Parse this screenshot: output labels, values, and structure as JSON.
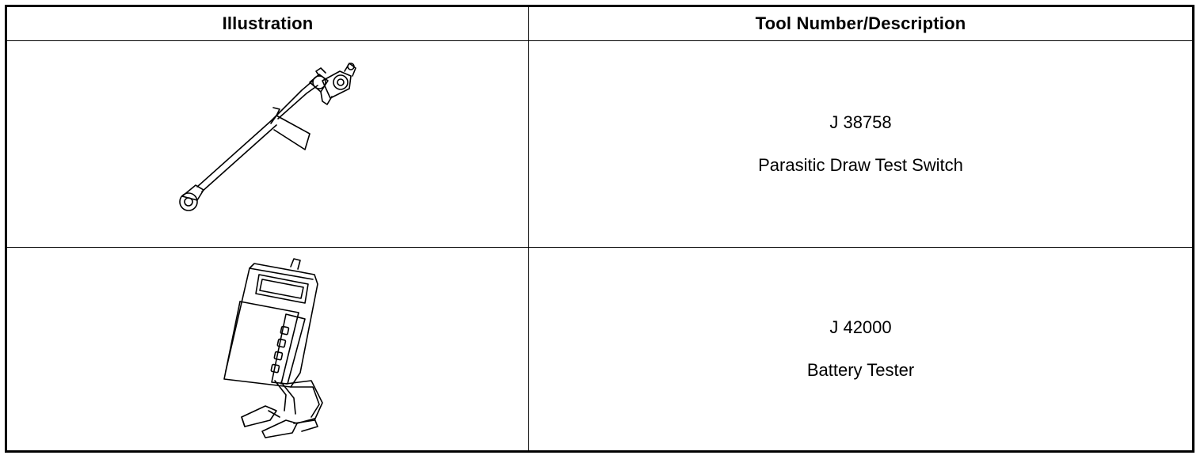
{
  "table": {
    "headers": {
      "illustration": "Illustration",
      "tool": "Tool Number/Description"
    },
    "rows": [
      {
        "illustration": "parasitic-draw-test-switch-drawing",
        "tool_number": "J 38758",
        "description": "Parasitic Draw Test Switch"
      },
      {
        "illustration": "battery-tester-drawing",
        "tool_number": "J 42000",
        "description": "Battery Tester"
      }
    ]
  }
}
